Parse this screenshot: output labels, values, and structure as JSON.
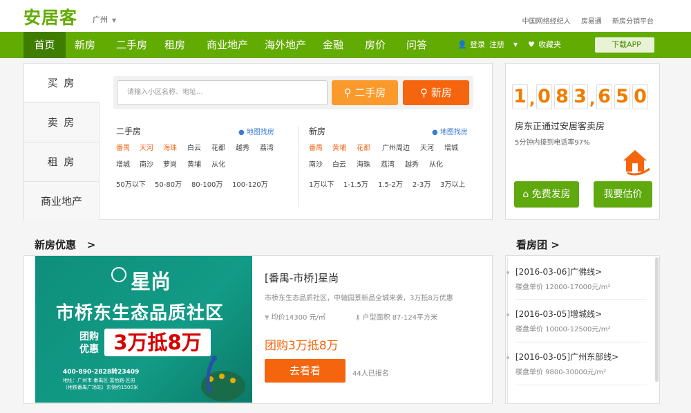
{
  "logo": "安居客",
  "city": "广州",
  "toplinks": [
    "中国网络经纪人",
    "房易通",
    "新房分销平台"
  ],
  "nav": [
    "首页",
    "新房",
    "二手房",
    "租房",
    "商业地产",
    "海外地产",
    "金融",
    "房价",
    "问答"
  ],
  "nav_right": {
    "login": "登录",
    "register": "注册",
    "favorites": "收藏夹"
  },
  "app_button": "下载APP",
  "tabs": [
    "买 房",
    "卖 房",
    "租 房",
    "商业地产"
  ],
  "search": {
    "placeholder": "请输入小区名称、地址...",
    "btn_second": "二手房",
    "btn_new": "新房"
  },
  "second": {
    "title": "二手房",
    "map": "地图找房",
    "row1": [
      "番禺",
      "天河",
      "海珠",
      "白云",
      "花都",
      "越秀",
      "荔湾"
    ],
    "row2": [
      "增城",
      "南沙",
      "萝岗",
      "黄埔",
      "从化"
    ],
    "prices": [
      "50万以下",
      "50-80万",
      "80-100万",
      "100-120万"
    ]
  },
  "newhouse": {
    "title": "新房",
    "map": "地图找房",
    "row1": [
      "番禺",
      "黄埔",
      "花都",
      "广州周边",
      "天河",
      "增城"
    ],
    "row2": [
      "南沙",
      "白云",
      "海珠",
      "荔湾",
      "越秀",
      "从化"
    ],
    "prices": [
      "1万以下",
      "1-1.5万",
      "1.5-2万",
      "2-3万",
      "3万以上"
    ]
  },
  "seller": {
    "digits": [
      "1",
      "0",
      "8",
      "3",
      "6",
      "5",
      "0"
    ],
    "line1": "房东正通过安居客卖房",
    "line2": "5分钟内接到电话率97%",
    "btn_post": "免费发房",
    "btn_price": "我要估价"
  },
  "promo_section": {
    "title": "新房优惠",
    "arrow": ">"
  },
  "promo": {
    "logo": "星尚",
    "line1": "市桥东生态品质社区",
    "small1": "团购",
    "small2": "优惠",
    "big": "3万抵8万",
    "phone": "400-890-2828转23409",
    "addr1": "地址：广州市·番禺区·富怡路·区府",
    "addr2": "（地铁番禺广场站）东侧约1500米"
  },
  "deal": {
    "title": "[番禺-市桥]星尚",
    "desc": "市桥东生态品质社区，中轴园景新品全城来袭，3万抵8万优惠",
    "avg": "均价14300 元/㎡",
    "area": "户型面积 87-124平方米",
    "tg": "团购3万抵8万",
    "btn": "去看看",
    "count": "44人已报名"
  },
  "tuan_section": {
    "title": "看房团",
    "arrow": ">"
  },
  "tuan": [
    {
      "title": "[2016-03-06]广佛线>",
      "price": "楼盘单价 12000-17000元/m²"
    },
    {
      "title": "[2016-03-05]增城线>",
      "price": "楼盘单价 10000-12500元/m²"
    },
    {
      "title": "[2016-03-05]广州东部线>",
      "price": "楼盘单价 9800-30000元/m²"
    }
  ],
  "colors": {
    "brand": "#62ab02",
    "orange": "#f5650d",
    "counter": "#f07d00"
  }
}
